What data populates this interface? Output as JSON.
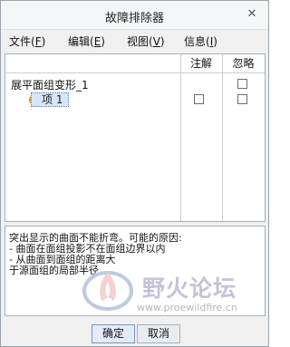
{
  "window": {
    "title": "故障排除器"
  },
  "menu": [
    {
      "label": "文件",
      "accel": "F"
    },
    {
      "label": "编辑",
      "accel": "E"
    },
    {
      "label": "视图",
      "accel": "V"
    },
    {
      "label": "信息",
      "accel": "I"
    }
  ],
  "tree": {
    "columns": {
      "note": "注解",
      "ignore": "忽略"
    },
    "rows": [
      {
        "label": "展平面组变形_1",
        "note_checked": false,
        "ignore_checked": false,
        "show_note": false,
        "show_ignore": true
      },
      {
        "label": "项 1",
        "note_checked": false,
        "ignore_checked": false,
        "show_note": true,
        "show_ignore": true,
        "selected": true
      }
    ]
  },
  "message": {
    "lines": [
      "突出显示的曲面不能折弯。可能的原因:",
      "- 曲面在面组投影不在面组边界以内",
      "- 从曲面到面组的距离大",
      "于源面组的局部半径"
    ]
  },
  "watermark": {
    "text": "野火论坛",
    "url": "www.proewildfire.cn"
  },
  "buttons": {
    "ok": "确定",
    "cancel": "取消"
  },
  "colors": {
    "selection": "#d6e6f7",
    "item_icon": "#f2b51c"
  }
}
